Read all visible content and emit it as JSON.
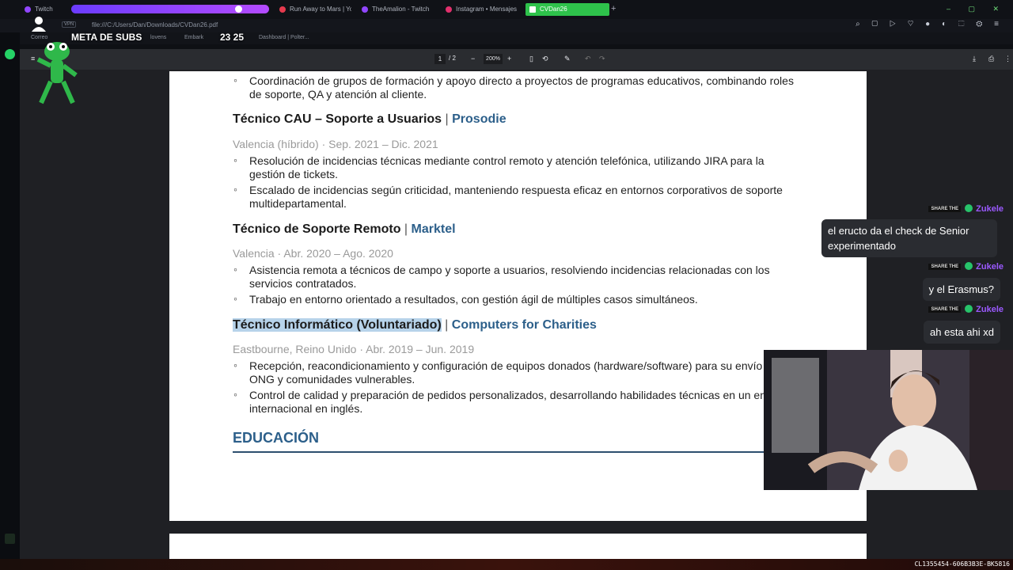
{
  "browser": {
    "tabs": [
      {
        "label": "Twitch",
        "color": "#9146ff"
      },
      {
        "label": "Run Away to Mars | Yo",
        "color": "#e63a4e"
      },
      {
        "label": "TheAmalion - Twitch",
        "color": "#9146ff"
      },
      {
        "label": "Instagram • Mensajes",
        "color": "#e1306c"
      },
      {
        "label": "CVDan26",
        "color": "#ffffff",
        "active": true
      }
    ],
    "url": "file:///C:/Users/Dan/Downloads/CVDan26.pdf",
    "vpn_label": "VPN",
    "bookmarks": [
      "Correo",
      "lovens",
      "Embark",
      "Dashboard | Polter..."
    ]
  },
  "overlay": {
    "subs_goal_label": "META DE SUBS",
    "subs_goal_count": "23 25"
  },
  "pdf_toolbar": {
    "page_current": "1",
    "page_total": "/ 2",
    "zoom": "200%"
  },
  "document": {
    "jobs": [
      {
        "title": "Técnico CAU – Soporte a Usuarios",
        "company": "Prosodie",
        "meta": "Valencia (híbrido) · Sep. 2021 – Dic. 2021",
        "bullets": [
          "Resolución de incidencias técnicas mediante control remoto y atención telefónica, utilizando JIRA para la gestión de tickets.",
          "Escalado de incidencias según criticidad, manteniendo respuesta eficaz en entornos corporativos de soporte multidepartamental."
        ]
      },
      {
        "title": "Técnico de Soporte Remoto",
        "company": "Marktel",
        "meta": "Valencia · Abr. 2020 – Ago. 2020",
        "bullets": [
          "Asistencia remota a técnicos de campo y soporte a usuarios, resolviendo incidencias relacionadas con los servicios contratados.",
          "Trabajo en entorno orientado a resultados, con gestión ágil de múltiples casos simultáneos."
        ]
      },
      {
        "title": "Técnico Informático (Voluntariado)",
        "company": "Computers for Charities",
        "meta": "Eastbourne, Reino Unido · Abr. 2019 – Jun. 2019",
        "bullets": [
          "Recepción, reacondicionamiento y configuración de equipos donados (hardware/software) para su envío a ONG y comunidades vulnerables.",
          "Control de calidad y preparación de pedidos personalizados, desarrollando habilidades técnicas en un entorno internacional en inglés."
        ]
      }
    ],
    "top_bullet": "Coordinación de grupos de formación y apoyo directo a proyectos de programas educativos, combinando roles de soporte, QA y atención al cliente.",
    "section_title": "EDUCACIÓN",
    "separator": "|"
  },
  "chat": {
    "badge": "SHARE THE",
    "user": "Zukele",
    "user_color": "#9b59ff",
    "messages": [
      "el eructo da el check de Senior experimentado",
      "y el Erasmus?",
      "ah esta ahi xd"
    ]
  },
  "stream_id": "CL1355454-606B3B3E-BK5816"
}
